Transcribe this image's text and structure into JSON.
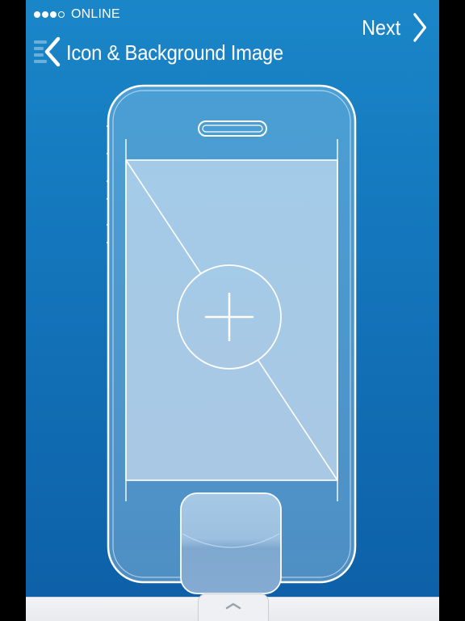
{
  "status_bar": {
    "signal_dots": [
      true,
      true,
      true,
      false
    ],
    "network_label": "ONLINE"
  },
  "nav": {
    "back_icon": "menu-back-icon",
    "title": "Icon & Background Image",
    "next_label": "Next",
    "next_icon": "chevron-right-icon"
  },
  "editor": {
    "device": "phone-outline",
    "add_icon": "plus-icon",
    "home_button_icon": "home-button-icon"
  },
  "bottom_drawer": {
    "handle_icon": "chevron-up-icon"
  },
  "colors": {
    "background_top": "#1a86c8",
    "background_bottom": "#0d5fa6",
    "outline": "#ffffff",
    "drawer": "#eef0f3"
  }
}
